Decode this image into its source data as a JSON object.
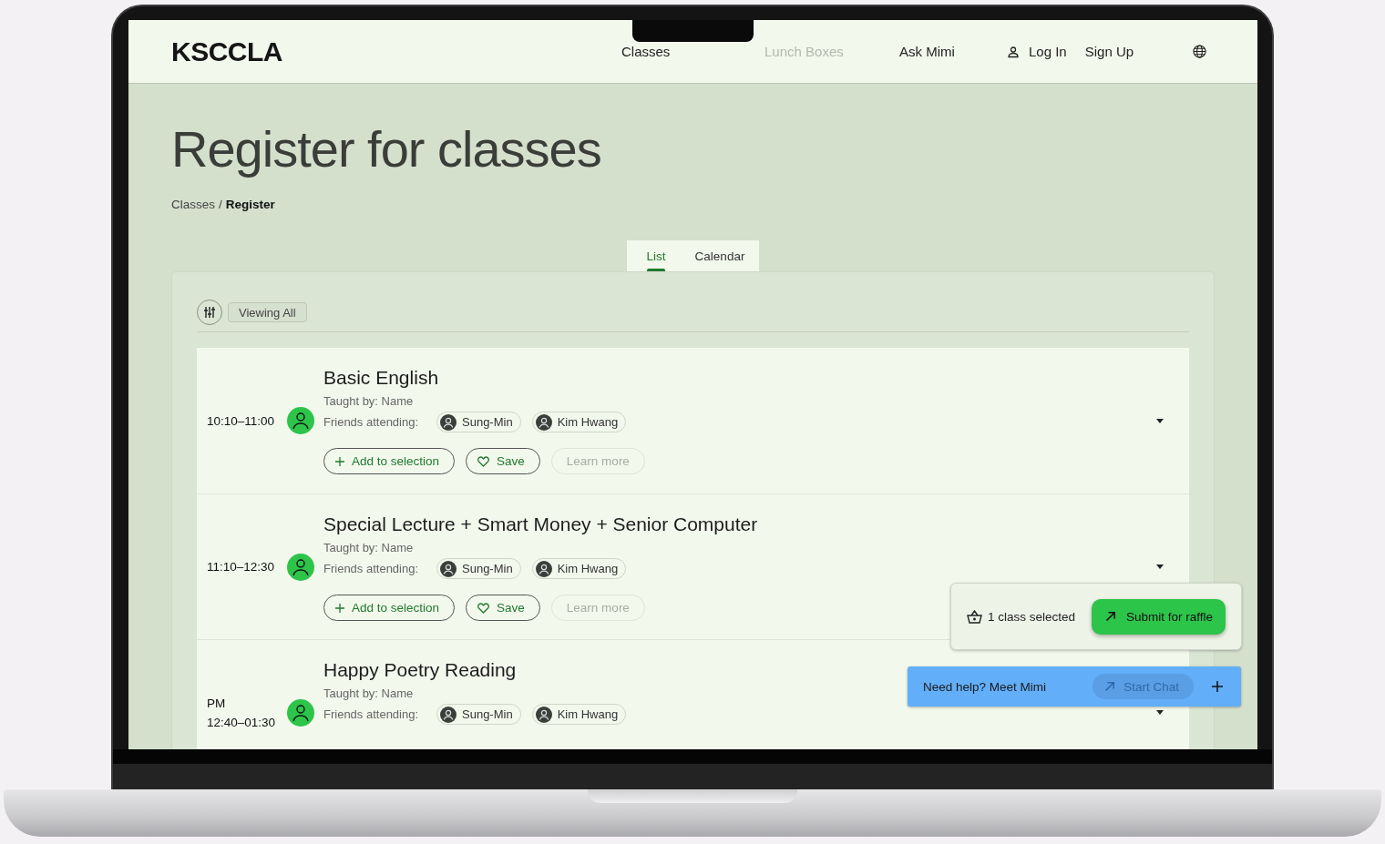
{
  "header": {
    "logo": "KSCCLA",
    "nav": [
      {
        "label": "Classes",
        "disabled": false
      },
      {
        "label": "Lunch Boxes",
        "disabled": true
      },
      {
        "label": "Ask Mimi",
        "disabled": false
      }
    ],
    "login": "Log In",
    "signup": "Sign Up"
  },
  "page": {
    "title": "Register for classes",
    "breadcrumb_separator": "/",
    "breadcrumb": [
      {
        "label": "Classes",
        "current": false
      },
      {
        "label": "Register",
        "current": true
      }
    ]
  },
  "view_tabs": [
    {
      "label": "List",
      "selected": true
    },
    {
      "label": "Calendar",
      "selected": false
    }
  ],
  "filter": {
    "chip": "Viewing All"
  },
  "classes": [
    {
      "time": "10:10–11:00",
      "title": "Basic English",
      "taught_by": "Taught by: Name",
      "friends_label": "Friends attending:",
      "friends": [
        "Sung-Min",
        "Kim Hwang"
      ],
      "expanded": false,
      "actions": [
        {
          "kind": "add",
          "label": "Add to selection",
          "disabled": false
        },
        {
          "kind": "save",
          "label": "Save",
          "disabled": false
        },
        {
          "kind": "learn",
          "label": "Learn more",
          "disabled": true
        }
      ]
    },
    {
      "time": "11:10–12:30",
      "title": "Special Lecture + Smart Money + Senior Computer",
      "taught_by": "Taught by: Name",
      "friends_label": "Friends attending:",
      "friends": [
        "Sung-Min",
        "Kim Hwang"
      ],
      "expanded": false,
      "actions": [
        {
          "kind": "add",
          "label": "Add to selection",
          "disabled": false
        },
        {
          "kind": "save",
          "label": "Save",
          "disabled": false
        },
        {
          "kind": "learn",
          "label": "Learn more",
          "disabled": true
        }
      ]
    },
    {
      "period": "PM",
      "time": "12:40–01:30",
      "title": "Happy Poetry Reading",
      "taught_by": "Taught by: Name",
      "friends_label": "Friends attending:",
      "friends": [
        "Sung-Min",
        "Kim Hwang"
      ],
      "expanded": false
    }
  ],
  "selection": {
    "count_text": "1 class selected",
    "submit": "Submit for raffle"
  },
  "chat": {
    "prompt": "Need help? Meet Mimi",
    "start": {
      "label": "Start Chat",
      "disabled": true
    }
  }
}
